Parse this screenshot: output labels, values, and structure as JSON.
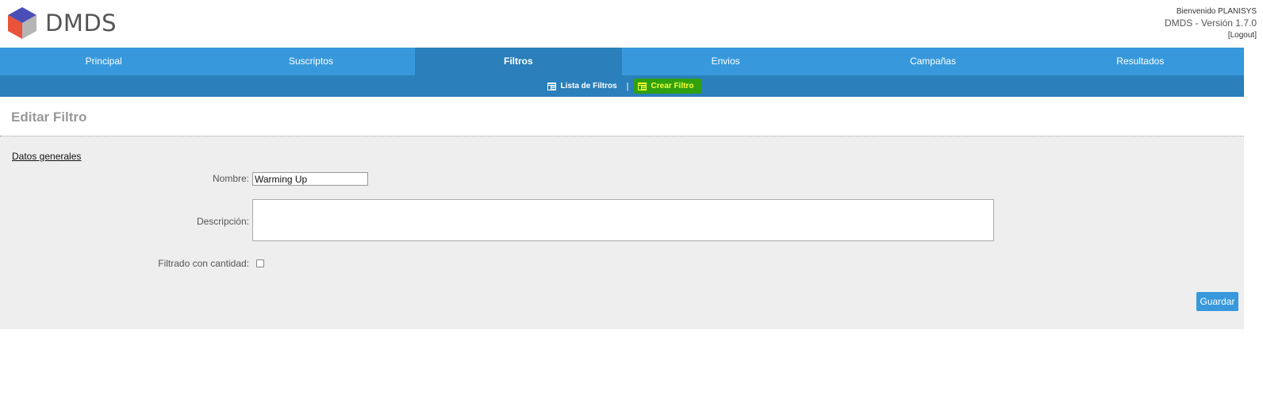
{
  "header": {
    "logo_text": "DMDS",
    "welcome": "Bienvenido PLANISYS",
    "version": "DMDS - Versión 1.7.0",
    "logout": "[Logout]"
  },
  "main_nav": {
    "items": [
      {
        "label": "Principal"
      },
      {
        "label": "Suscriptos"
      },
      {
        "label": "Filtros",
        "active": true
      },
      {
        "label": "Envios"
      },
      {
        "label": "Campañas"
      },
      {
        "label": "Resultados"
      }
    ]
  },
  "sub_nav": {
    "items": [
      {
        "label": "Lista de Filtros",
        "icon": "list-icon"
      },
      {
        "label": "Crear Filtro",
        "icon": "add-filter-icon",
        "highlight_color": "#2fa010"
      }
    ],
    "separator": "|"
  },
  "page": {
    "title": "Editar Filtro"
  },
  "form": {
    "section_title": "Datos generales",
    "nombre_label": "Nombre:",
    "nombre_value": "Warming Up",
    "descripcion_label": "Descripción:",
    "descripcion_value": "",
    "cantidad_label": "Filtrado con cantidad:",
    "cantidad_checked": false,
    "save_label": "Guardar"
  },
  "colors": {
    "nav_blue": "#3799dc",
    "nav_dark_blue": "#2b7fba",
    "panel_bg": "#eeeeee"
  }
}
